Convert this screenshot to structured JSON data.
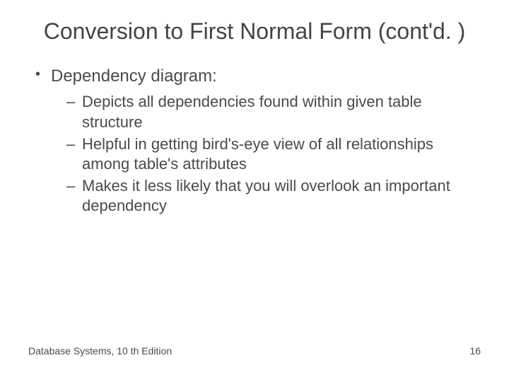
{
  "title": "Conversion to First Normal Form (cont'd. )",
  "bullets": {
    "main": "Dependency diagram:",
    "sub1": "Depicts all dependencies found within given table structure",
    "sub2": "Helpful in getting bird's-eye view of all relationships among table's attributes",
    "sub3": "Makes it less likely that you will overlook an important dependency"
  },
  "footer": {
    "left": "Database Systems, 10 th Edition",
    "right": "16"
  }
}
